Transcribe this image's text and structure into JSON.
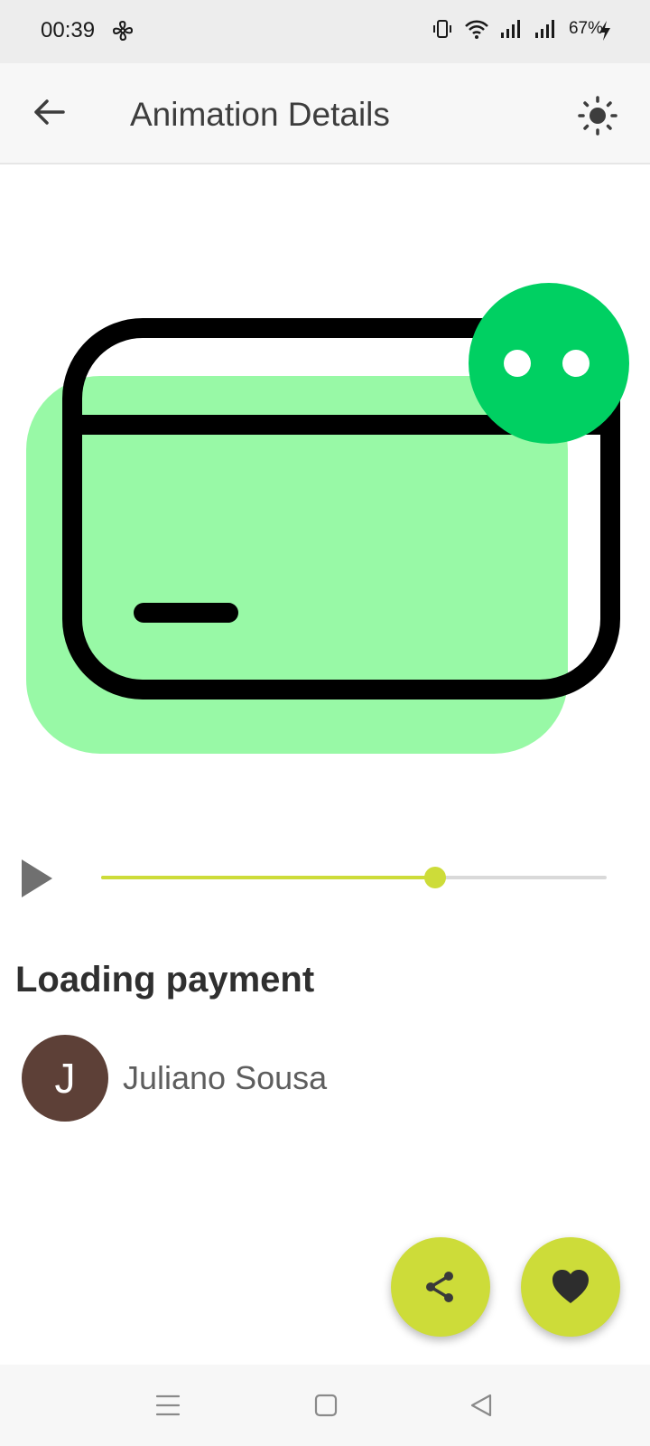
{
  "status_bar": {
    "time": "00:39",
    "battery": "67%"
  },
  "app_bar": {
    "title": "Animation Details",
    "back_icon": "arrow-left-icon",
    "theme_icon": "sun-icon"
  },
  "animation": {
    "name": "Loading payment",
    "progress": 0.66,
    "colors": {
      "card_fill": "#98f9a6",
      "card_stroke": "#000000",
      "badge": "#00d062"
    }
  },
  "author": {
    "initial": "J",
    "name": "Juliano Sousa",
    "avatar_color": "#5d4037"
  },
  "actions": {
    "share_icon": "share-icon",
    "favorite_icon": "heart-icon",
    "accent": "#cddc39"
  },
  "nav_bar": {
    "menu_icon": "menu-icon",
    "home_icon": "square-icon",
    "back_icon": "triangle-back-icon"
  }
}
